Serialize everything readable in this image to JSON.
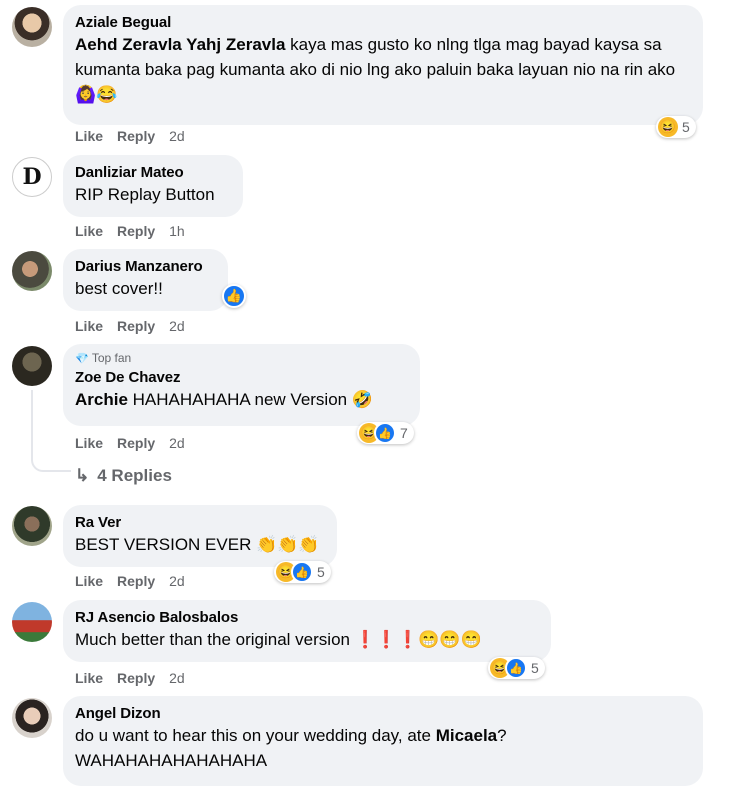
{
  "comments": [
    {
      "author": "Aziale Begual",
      "mention": "Aehd Zeravla Yahj Zeravla",
      "text": " kaya mas gusto ko nlng tlga mag bayad kaysa sa kumanta baka pag kumanta ako di nio lng ako paluin baka layuan nio na rin ako 🙆‍♀️😂",
      "like": "Like",
      "reply": "Reply",
      "time": "2d",
      "reaction_count": "5"
    },
    {
      "author": "Danliziar Mateo",
      "text": "RIP Replay Button",
      "like": "Like",
      "reply": "Reply",
      "time": "1h"
    },
    {
      "author": "Darius Manzanero",
      "text": "best cover!!",
      "like": "Like",
      "reply": "Reply",
      "time": "2d"
    },
    {
      "badge": "Top fan",
      "author": "Zoe De Chavez",
      "mention": "Archie",
      "text": " HAHAHAHAHA new Version 🤣",
      "like": "Like",
      "reply": "Reply",
      "time": "2d",
      "reaction_count": "7",
      "replies": "4 Replies"
    },
    {
      "author": "Ra Ver",
      "text": "BEST VERSION EVER 👏👏👏",
      "like": "Like",
      "reply": "Reply",
      "time": "2d",
      "reaction_count": "5"
    },
    {
      "author": "RJ Asencio Balosbalos",
      "text": "Much better than the original version ❗❗❗😁😁😁",
      "like": "Like",
      "reply": "Reply",
      "time": "2d",
      "reaction_count": "5"
    },
    {
      "author": "Angel Dizon",
      "text_before": "do u want to hear this on your wedding day, ate ",
      "mention": "Micaela",
      "text_after": "?",
      "line2": "WAHAHAHAHAHAHAHA"
    }
  ],
  "icons": {
    "haha": "😆",
    "like": "👍",
    "replies_arrow": "↳",
    "gem": "💎"
  },
  "colors": {
    "bubble": "#f0f2f5",
    "meta": "#65676b",
    "like_blue": "#1877f2",
    "haha_yellow": "#f7b928"
  }
}
